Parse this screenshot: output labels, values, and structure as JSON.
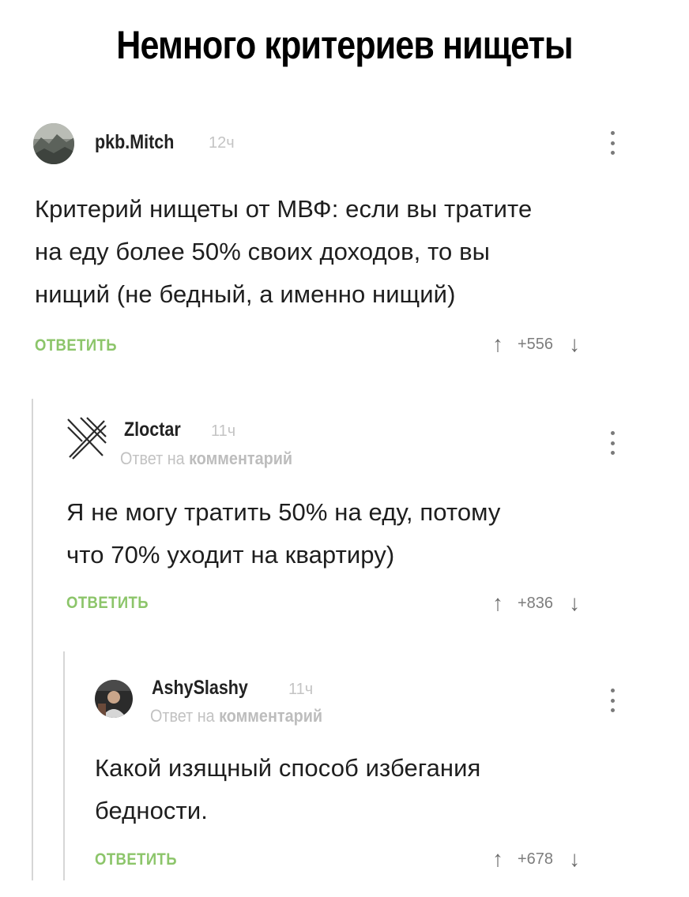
{
  "title": "Немного критериев нищеты",
  "reply_label": "ОТВЕТИТЬ",
  "reply_to_prefix": "Ответ на",
  "reply_to_target": "комментарий",
  "comments": [
    {
      "username": "pkb.Mitch",
      "time": "12ч",
      "text_lines": [
        "Критерий нищеты от МВФ: если вы тратите",
        "на еду более 50% своих доходов, то вы",
        "нищий (не бедный, а именно нищий)"
      ],
      "rating": "+556"
    },
    {
      "username": "Zloctar",
      "time": "11ч",
      "text_lines": [
        "Я не могу тратить 50% на еду, потому",
        "что  70% уходит на квартиру)"
      ],
      "rating": "+836"
    },
    {
      "username": "AshySlashy",
      "time": "11ч",
      "text_lines": [
        "Какой изящный способ избегания",
        "бедности."
      ],
      "rating": "+678"
    }
  ],
  "icons": {
    "upvote": "upvote-arrow-icon",
    "downvote": "downvote-arrow-icon",
    "more": "kebab-menu-icon"
  }
}
